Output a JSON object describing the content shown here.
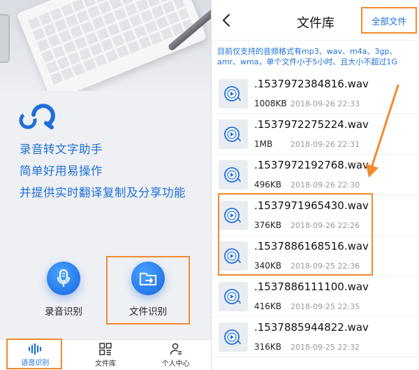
{
  "left_screen": {
    "slogans": [
      "录音转文字助手",
      "简单好用易操作",
      "并提供实时翻译复制及分享功能"
    ],
    "features": {
      "record": {
        "label": "录音识别",
        "icon": "microphone-icon"
      },
      "file": {
        "label": "文件识别",
        "icon": "folder-arrow-icon"
      }
    },
    "tabs": [
      {
        "label": "语音识别",
        "icon": "sound-wave-icon",
        "active": true
      },
      {
        "label": "文件库",
        "icon": "grid-icon",
        "active": false
      },
      {
        "label": "个人中心",
        "icon": "person-icon",
        "active": false
      }
    ]
  },
  "right_screen": {
    "title": "文件库",
    "all_files_label": "全部文件",
    "notice": "目前仅支持的音频格式有mp3、wav、m4a、3gp、amr、wma，单个文件小于5小时、且大小不超过1G",
    "files": [
      {
        "name": ".1537972384816.wav",
        "size": "1008KB",
        "time": "2018-09-26 22:33"
      },
      {
        "name": ".1537972275224.wav",
        "size": "1MB",
        "time": "2018-09-26 22:31"
      },
      {
        "name": ".1537972192768.wav",
        "size": "496KB",
        "time": "2018-09-26 22:30"
      },
      {
        "name": ".1537971965430.wav",
        "size": "376KB",
        "time": "2018-09-26 22:26"
      },
      {
        "name": ".1537886168516.wav",
        "size": "340KB",
        "time": "2018-09-25 22:36"
      },
      {
        "name": ".1537886111100.wav",
        "size": "416KB",
        "time": "2018-09-25 22:35"
      },
      {
        "name": ".1537885944822.wav",
        "size": "316KB",
        "time": "2018-09-25 22:32"
      }
    ]
  },
  "colors": {
    "accent": "#1e6fd6",
    "highlight": "#f28a2e"
  }
}
